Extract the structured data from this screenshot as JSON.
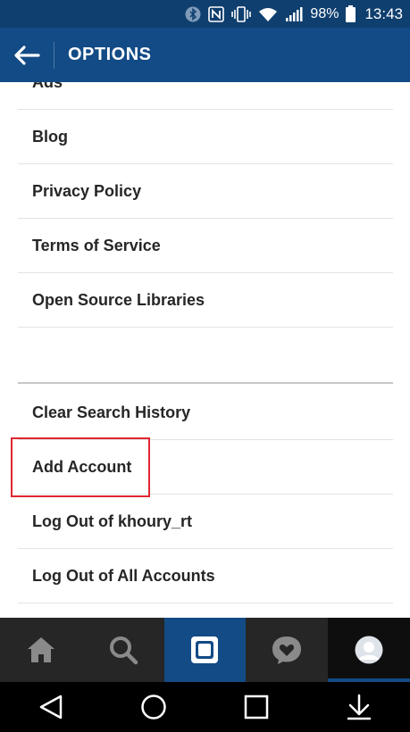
{
  "status_bar": {
    "battery_percent": "98%",
    "time": "13:43",
    "icons": [
      "bluetooth-icon",
      "nfc-icon",
      "vibrate-icon",
      "wifi-icon",
      "signal-icon",
      "battery-icon"
    ]
  },
  "app_bar": {
    "title": "OPTIONS",
    "back_icon": "back-arrow-icon"
  },
  "list": {
    "partial_item": "Ads",
    "section1": [
      "Blog",
      "Privacy Policy",
      "Terms of Service",
      "Open Source Libraries"
    ],
    "section2": [
      "Clear Search History",
      "Add Account",
      "Log Out of khoury_rt",
      "Log Out of All Accounts"
    ]
  },
  "highlight_color": "#e0262f",
  "tab_bar": {
    "tabs": [
      "home-icon",
      "search-icon",
      "camera-icon",
      "activity-heart-icon",
      "profile-avatar-icon"
    ],
    "active_tab": "camera-icon"
  },
  "nav_bar": {
    "buttons": [
      "back-triangle-icon",
      "home-circle-icon",
      "recents-square-icon",
      "notification-down-icon"
    ]
  },
  "colors": {
    "app_bar": "#124b85",
    "status_bar": "#0f3f6e",
    "tab_bar": "#262626"
  }
}
